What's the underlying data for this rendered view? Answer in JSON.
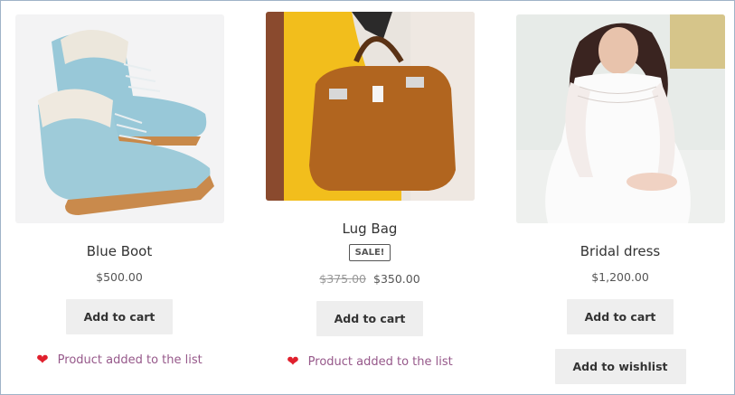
{
  "products": [
    {
      "name": "Blue Boot",
      "price": "$500.00",
      "add_to_cart": "Add to cart",
      "wishlist_status": "Product added to the list",
      "image": "blue-boots-photo"
    },
    {
      "name": "Lug Bag",
      "badge": "SALE!",
      "old_price": "$375.00",
      "price": "$350.00",
      "add_to_cart": "Add to cart",
      "wishlist_status": "Product added to the list",
      "image": "brown-handbag-photo"
    },
    {
      "name": "Bridal dress",
      "price": "$1,200.00",
      "add_to_cart": "Add to cart",
      "add_to_wishlist": "Add to wishlist",
      "image": "bridal-dress-photo"
    }
  ],
  "colors": {
    "wishlist_text": "#96588a",
    "heart": "#e0202d",
    "button_bg": "#eeeeee"
  },
  "icons": {
    "added": "heart-icon"
  }
}
